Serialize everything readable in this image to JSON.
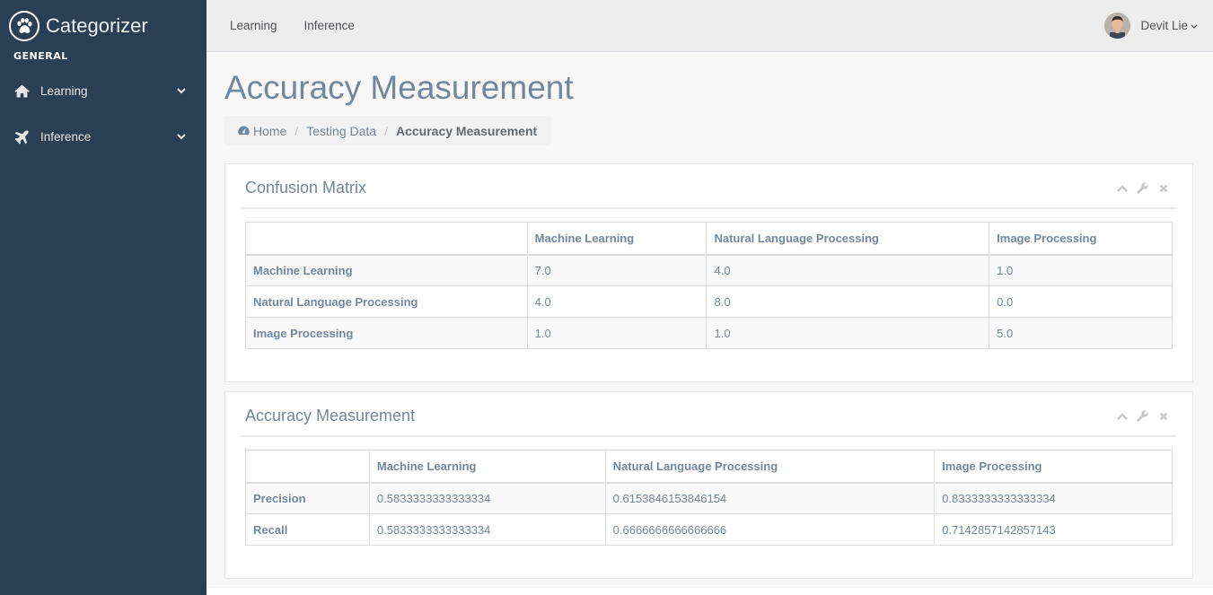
{
  "sidebar": {
    "brand": "Categorizer",
    "section": "GENERAL",
    "items": [
      {
        "label": "Learning",
        "icon": "home-icon"
      },
      {
        "label": "Inference",
        "icon": "plane-icon"
      }
    ]
  },
  "topnav": {
    "links": [
      "Learning",
      "Inference"
    ],
    "user": {
      "name": "Devit Lie"
    }
  },
  "page": {
    "title": "Accuracy Measurement",
    "breadcrumb": [
      "Home",
      "Testing Data",
      "Accuracy Measurement"
    ]
  },
  "confusion": {
    "title": "Confusion Matrix",
    "headers": [
      "",
      "Machine Learning",
      "Natural Language Processing",
      "Image Processing"
    ],
    "rows": [
      {
        "label": "Machine Learning",
        "values": [
          "7.0",
          "4.0",
          "1.0"
        ]
      },
      {
        "label": "Natural Language Processing",
        "values": [
          "4.0",
          "8.0",
          "0.0"
        ]
      },
      {
        "label": "Image Processing",
        "values": [
          "1.0",
          "1.0",
          "5.0"
        ]
      }
    ]
  },
  "accuracy": {
    "title": "Accuracy Measurement",
    "headers": [
      "",
      "Machine Learning",
      "Natural Language Processing",
      "Image Processing"
    ],
    "rows": [
      {
        "label": "Precision",
        "values": [
          "0.5833333333333334",
          "0.6153846153846154",
          "0.8333333333333334"
        ]
      },
      {
        "label": "Recall",
        "values": [
          "0.5833333333333334",
          "0.6666666666666666",
          "0.7142857142857143"
        ]
      }
    ]
  },
  "colors": {
    "sidebar_bg": "#2A3F54",
    "text": "#73879C",
    "topnav_bg": "#EDEDED"
  }
}
